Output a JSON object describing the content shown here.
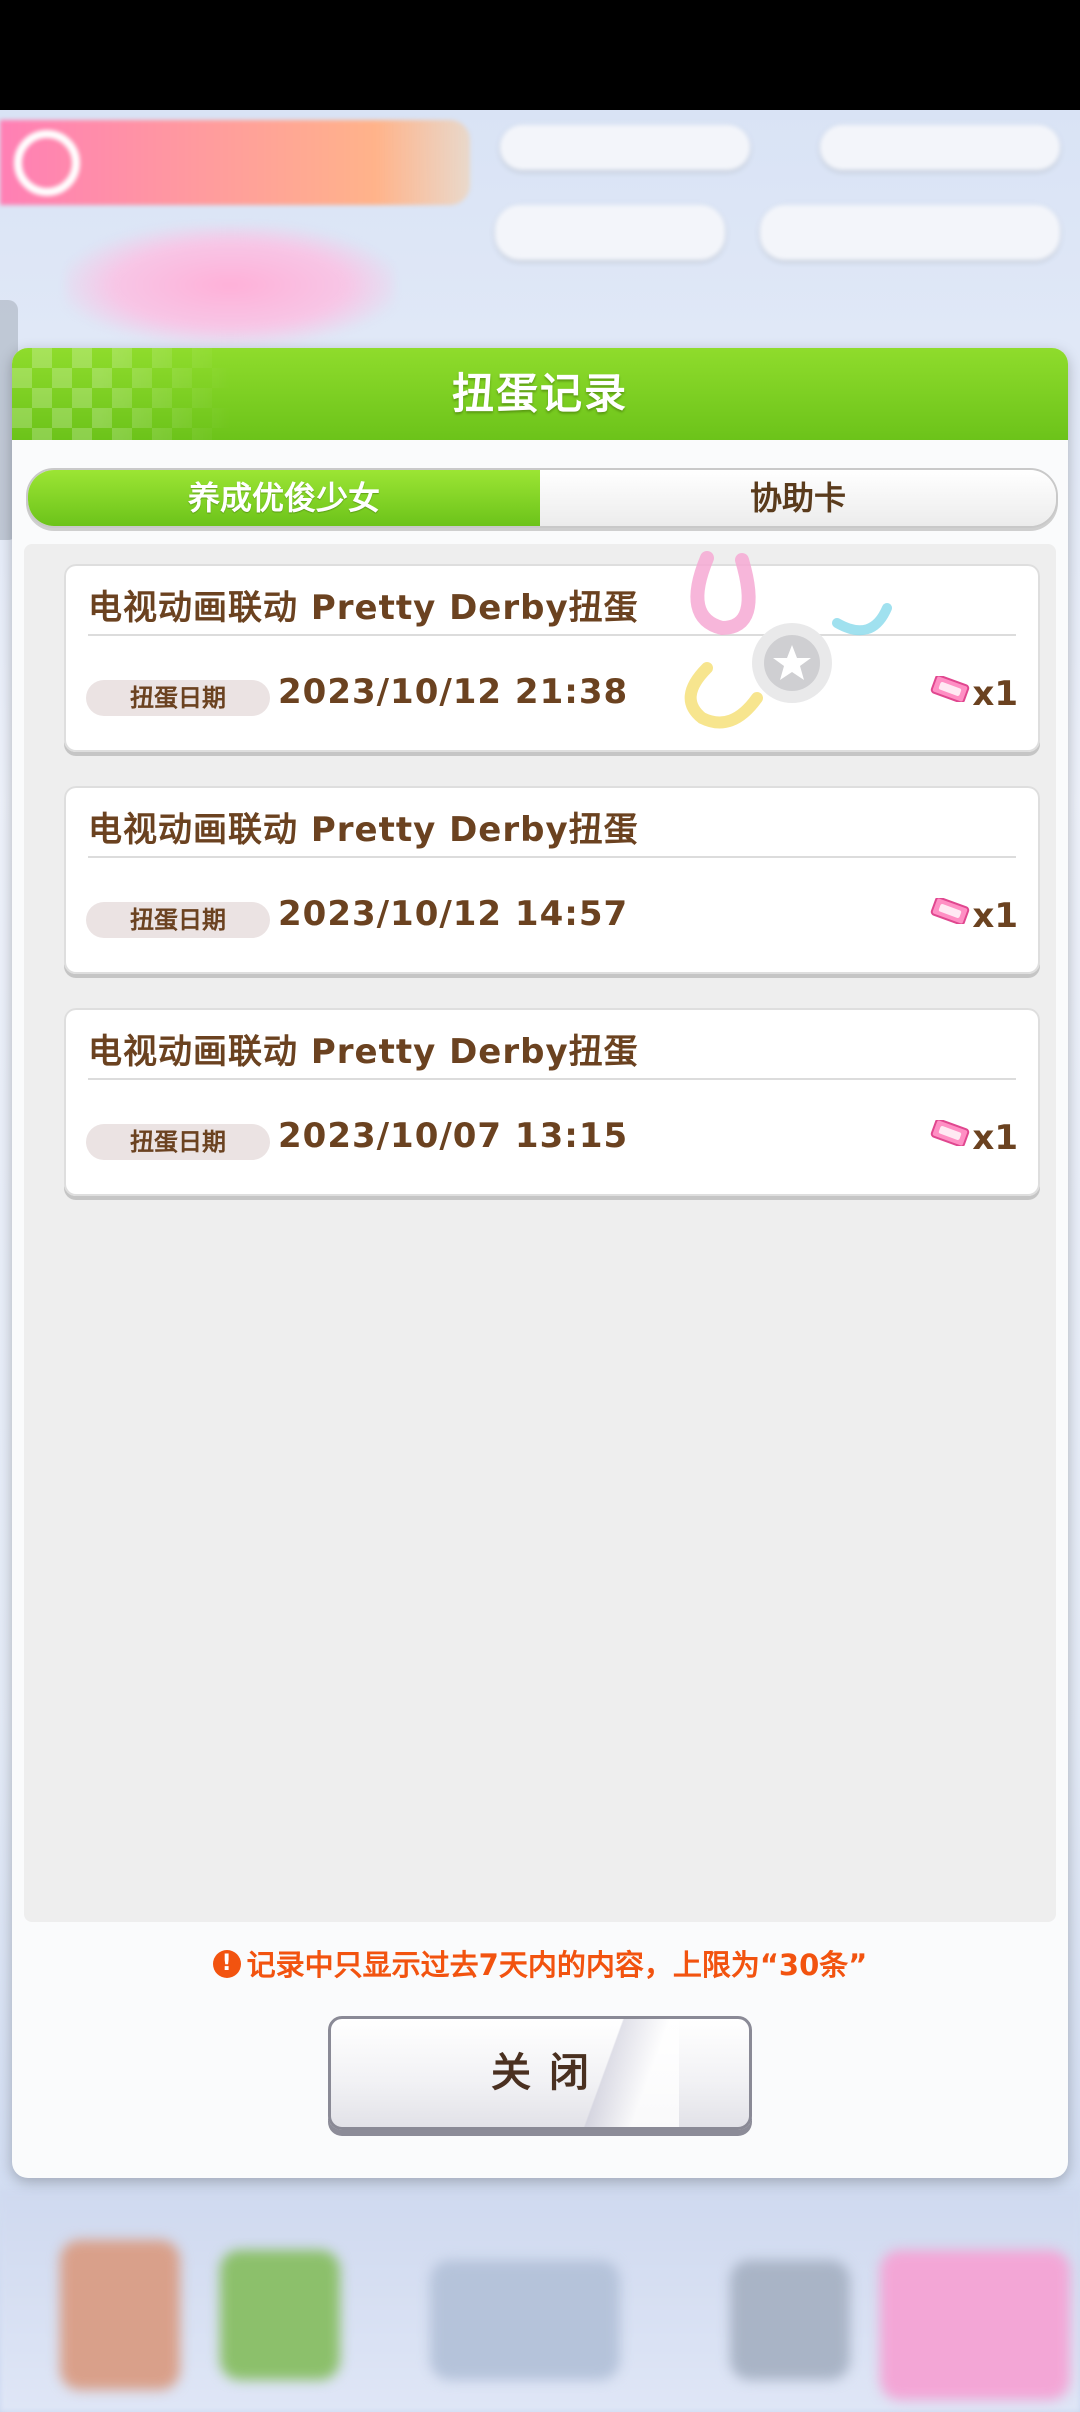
{
  "dialog": {
    "title": "扭蛋记录",
    "tabs": [
      {
        "label": "养成优俊少女",
        "active": true
      },
      {
        "label": "协助卡",
        "active": false
      }
    ],
    "records": [
      {
        "name": "电视动画联动 Pretty Derby扭蛋",
        "date_label": "扭蛋日期",
        "date": "2023/10/12  21:38",
        "quantity": "x1",
        "icon": "ticket-icon"
      },
      {
        "name": "电视动画联动 Pretty Derby扭蛋",
        "date_label": "扭蛋日期",
        "date": "2023/10/12  14:57",
        "quantity": "x1",
        "icon": "ticket-icon"
      },
      {
        "name": "电视动画联动 Pretty Derby扭蛋",
        "date_label": "扭蛋日期",
        "date": "2023/10/07  13:15",
        "quantity": "x1",
        "icon": "ticket-icon"
      }
    ],
    "notice": {
      "icon": "!",
      "text": "记录中只显示过去7天内的内容，上限为“30条”"
    },
    "close_label": "关闭"
  },
  "colors": {
    "header_green": "#6cc31a",
    "text_brown": "#6b4220",
    "notice_orange": "#f2530f"
  }
}
